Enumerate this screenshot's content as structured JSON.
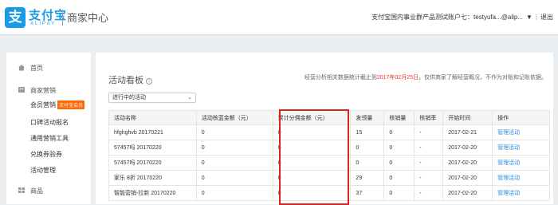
{
  "header": {
    "logo_glyph": "支",
    "logo_cn": "支付宝",
    "logo_en": "ALIPAY",
    "subtitle": "商家中心",
    "account_text": "支付宝国内事业群产品测试账户七：testyufa...@alip...",
    "dropdown_glyph": "▼",
    "separator": "|",
    "logout": "退出",
    "brand_color": "#1a9be8"
  },
  "sidebar": {
    "home": "首页",
    "marketing": "商家营销",
    "member_marketing": "会员营销",
    "member_tag": "支付宝会员",
    "koubei": "口碑活动报名",
    "general_tools": "通用营销工具",
    "coupon": "兑换券验券",
    "activity_mgmt": "活动管理",
    "goods": "商品"
  },
  "main": {
    "title": "活动看板",
    "info_glyph": "i",
    "notice_pre": "经营分析相关数据统计截止到",
    "notice_date": "2017年02月25日",
    "notice_post": "，仅供商家了解经营概况，不作为对账和记账依据。",
    "filter_value": "进行中的活动",
    "filter_arrow": "⌄",
    "columns": [
      "活动名称",
      "活动核蓝金额（元）",
      "累计分佣金额（元）",
      "发领量",
      "核销量",
      "核销率",
      "开始时间",
      "操作"
    ],
    "rows": [
      [
        "hfghghvb 20170221",
        "0",
        "0",
        "15",
        "0",
        "-",
        "2017-02-21",
        "管理活动"
      ],
      [
        "57457吗 20170220",
        "0",
        "0",
        "0",
        "0",
        "-",
        "2017-02-20",
        "管理活动"
      ],
      [
        "57457吗 20170220",
        "0",
        "0",
        "0",
        "0",
        "-",
        "2017-02-20",
        "管理活动"
      ],
      [
        "家乐 8折 20170220",
        "0",
        "0",
        "29",
        "0",
        "-",
        "2017-02-20",
        "管理活动"
      ],
      [
        "智能营销-拉新 20170220",
        "0",
        "0",
        "37",
        "0",
        "-",
        "2017-02-20",
        "管理活动"
      ]
    ]
  }
}
